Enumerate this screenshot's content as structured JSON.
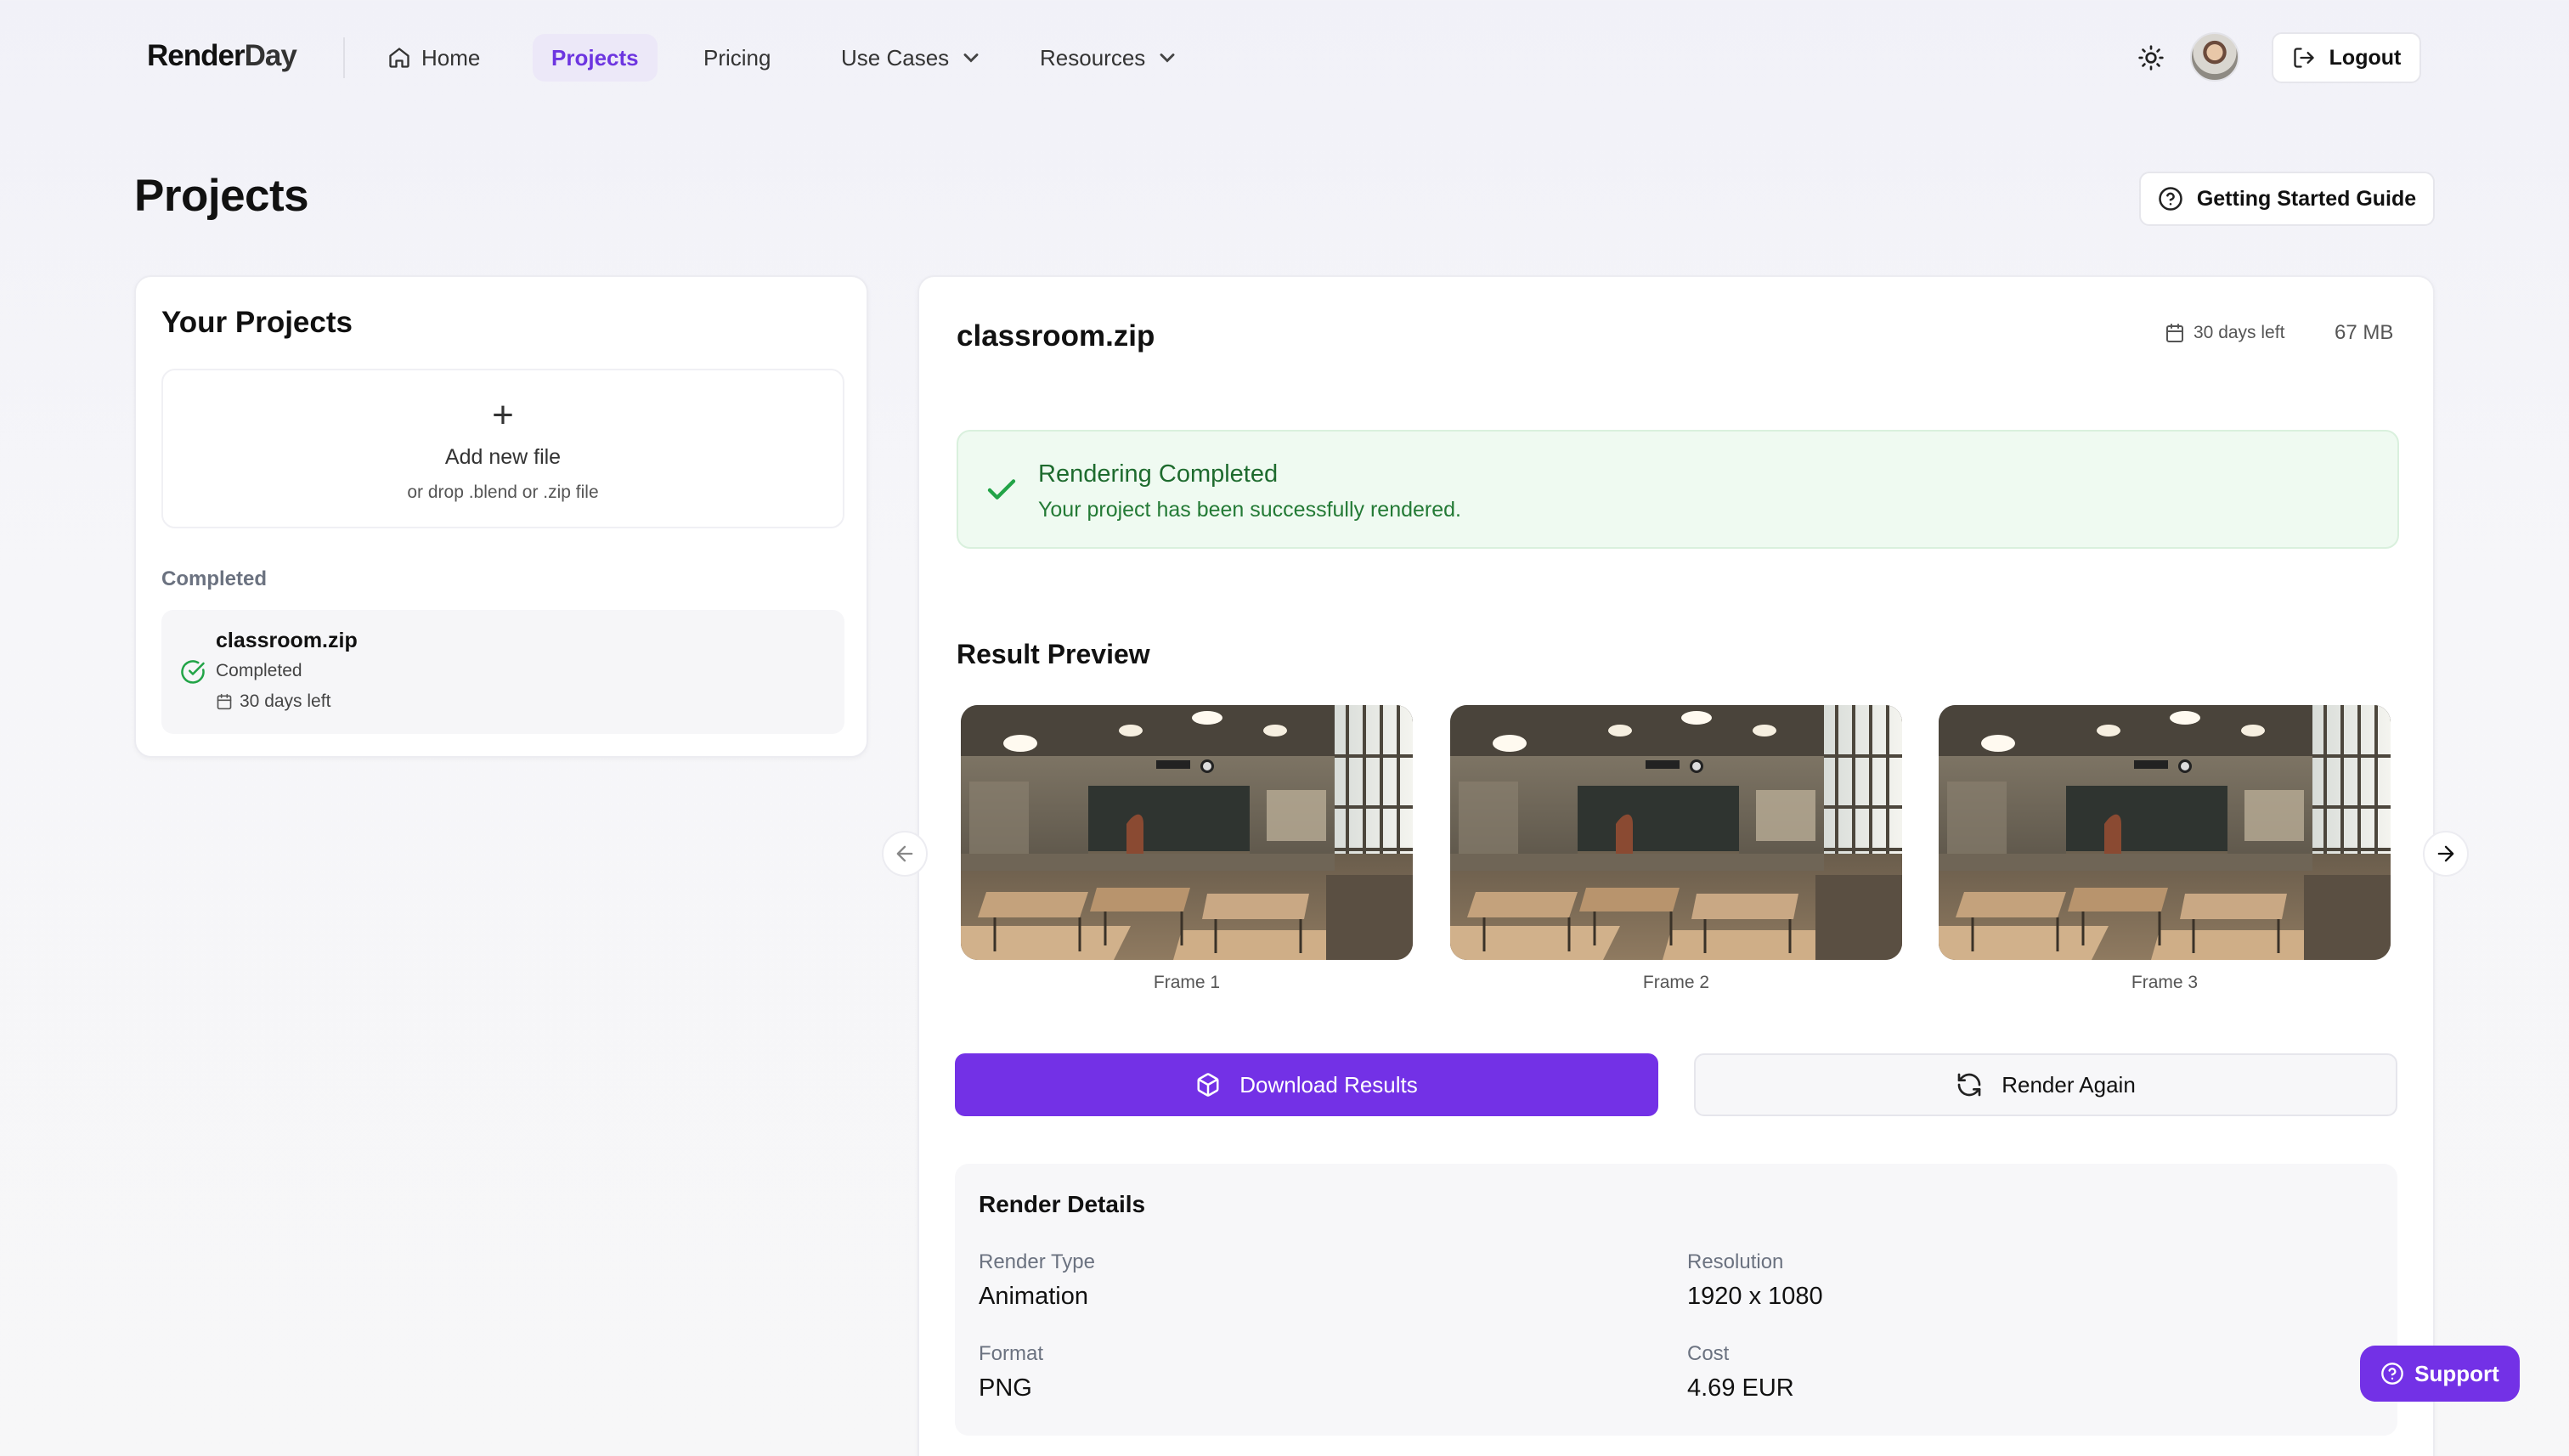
{
  "nav": {
    "logo_main": "Render",
    "logo_accent": "Day",
    "items": [
      {
        "label": "Home"
      },
      {
        "label": "Projects"
      },
      {
        "label": "Pricing"
      },
      {
        "label": "Use Cases"
      },
      {
        "label": "Resources"
      }
    ],
    "logout_label": "Logout"
  },
  "header": {
    "title": "Projects",
    "guide_label": "Getting Started Guide"
  },
  "sidebar": {
    "title": "Your Projects",
    "dropzone": {
      "plus": "+",
      "title": "Add new file",
      "subtitle": "or drop .blend or .zip file"
    },
    "section_label": "Completed",
    "projects": [
      {
        "name": "classroom.zip",
        "status": "Completed",
        "days_left": "30 days left"
      }
    ]
  },
  "detail": {
    "file_name": "classroom.zip",
    "days_left": "30 days left",
    "size": "67 MB",
    "alert": {
      "title": "Rendering Completed",
      "message": "Your project has been successfully rendered."
    },
    "preview_title": "Result Preview",
    "frames": [
      {
        "label": "Frame 1"
      },
      {
        "label": "Frame 2"
      },
      {
        "label": "Frame 3"
      }
    ],
    "download_label": "Download Results",
    "render_again_label": "Render Again",
    "details": {
      "title": "Render Details",
      "render_type_label": "Render Type",
      "render_type": "Animation",
      "resolution_label": "Resolution",
      "resolution": "1920 x 1080",
      "format_label": "Format",
      "format": "PNG",
      "cost_label": "Cost",
      "cost": "4.69 EUR"
    }
  },
  "support_label": "Support",
  "colors": {
    "accent": "#7331e6",
    "success_bg": "#effaf1",
    "success_text": "#1e6b2e"
  }
}
